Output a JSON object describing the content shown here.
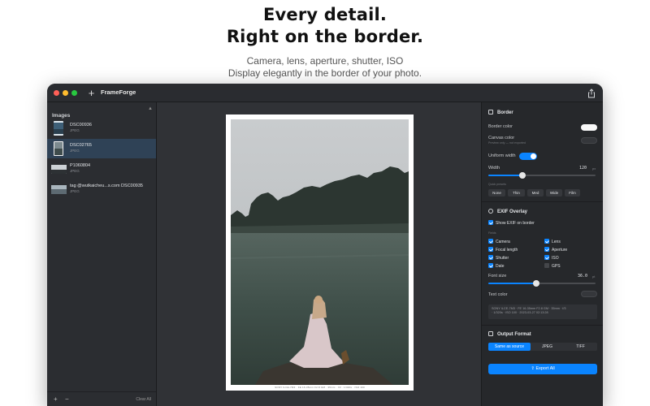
{
  "hero": {
    "title_line1": "Every detail.",
    "title_line2": "Right on the border.",
    "subtitle_line1": "Camera, lens, aperture, shutter, ISO",
    "subtitle_line2": "Display elegantly in the border of your photo."
  },
  "window": {
    "app_title": "FrameForge",
    "add_label": "+"
  },
  "sidebar": {
    "header": "Images",
    "files": [
      {
        "name": "DSC00936",
        "ext": "JPEG"
      },
      {
        "name": "DSC02765",
        "ext": "JPEG"
      },
      {
        "name": "P1060804",
        "ext": "JPEG"
      },
      {
        "name": "tag @wutkaicheu...s.com DSC00935",
        "ext": "JPEG"
      }
    ],
    "footer": {
      "add": "+",
      "remove": "−",
      "clear": "Clear All"
    }
  },
  "canvas": {
    "exif_caption": "SONY ILCE-7M3 · FE 16-35mm F2.8 GM · 35mm · f/3 · 1/320s · ISO 100"
  },
  "border": {
    "title": "Border",
    "border_color_label": "Border color",
    "canvas_color_label": "Canvas color",
    "canvas_color_note": "Preview only — not exported",
    "uniform_width_label": "Uniform width",
    "width_label": "Width",
    "width_value": "120",
    "width_unit": "px",
    "width_fraction": 0.32,
    "quick_presets_label": "Quick presets",
    "presets": [
      "None",
      "Thin",
      "Med",
      "Wide",
      "Film"
    ]
  },
  "exif": {
    "title": "EXIF Overlay",
    "show_label": "Show EXIF on border",
    "fields_label": "Fields",
    "fields": [
      {
        "label": "Camera",
        "checked": true
      },
      {
        "label": "Lens",
        "checked": true
      },
      {
        "label": "Focal length",
        "checked": true
      },
      {
        "label": "Aperture",
        "checked": true
      },
      {
        "label": "Shutter",
        "checked": true
      },
      {
        "label": "ISO",
        "checked": true
      },
      {
        "label": "Date",
        "checked": true
      },
      {
        "label": "GPS",
        "checked": false
      }
    ],
    "font_size_label": "Font size",
    "font_size_value": "36.0",
    "font_size_unit": "pt",
    "font_size_fraction": 0.45,
    "text_color_label": "Text color",
    "preview_line1": "SONY ILCE-7M3 · FE 16-35mm F2.8 GM · 35mm · f/3",
    "preview_line2": "· 1/320s · ISO 100 · 2023-03-27 02:13:28"
  },
  "output": {
    "title": "Output Format",
    "options": [
      "Same as source",
      "JPEG",
      "TIFF"
    ],
    "selected": "Same as source",
    "export_label": "Export All"
  },
  "colors": {
    "accent": "#0a84ff",
    "window_bg": "#232528",
    "sidebar_bg": "#2b2d31",
    "canvas_bg": "#303236"
  }
}
